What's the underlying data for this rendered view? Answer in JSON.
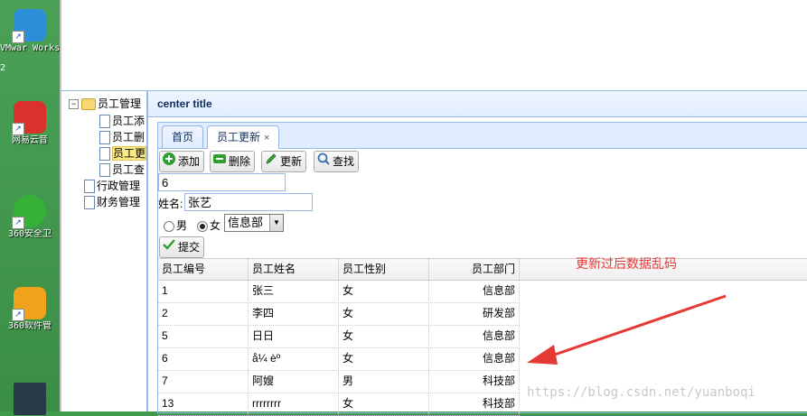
{
  "desktop": {
    "icons": [
      {
        "label": "VMwar Workstat",
        "color": "#2a8fd6"
      },
      {
        "label": "网易云音",
        "color": "#d9312b"
      },
      {
        "label": "360安全卫",
        "color": "#35b236"
      },
      {
        "label": "360软件管",
        "color": "#f0a21c"
      }
    ],
    "edge_label": "2"
  },
  "center": {
    "title": "center title"
  },
  "tree": {
    "root": "员工管理",
    "children": [
      "员工添",
      "员工删",
      "员工更",
      "员工查"
    ],
    "selected_index": 2,
    "siblings": [
      "行政管理",
      "财务管理"
    ]
  },
  "tabs": [
    {
      "label": "首页",
      "active": false
    },
    {
      "label": "员工更新",
      "active": true,
      "close": "×"
    }
  ],
  "toolbar": {
    "add": "添加",
    "delete": "删除",
    "update": "更新",
    "search": "查找"
  },
  "form": {
    "id_value": "6",
    "name_label": "姓名:",
    "name_value": "张艺",
    "male_label": "男",
    "female_label": "女",
    "gender_selected": "女",
    "dept_selected": "信息部",
    "submit": "提交"
  },
  "grid": {
    "columns": [
      "员工编号",
      "员工姓名",
      "员工性别",
      "员工部门"
    ],
    "rows": [
      [
        "1",
        "张三",
        "女",
        "信息部"
      ],
      [
        "2",
        "李四",
        "女",
        "研发部"
      ],
      [
        "5",
        "日日",
        "女",
        "信息部"
      ],
      [
        "6",
        "å¼ èº",
        "女",
        "信息部"
      ],
      [
        "7",
        "阿嫂",
        "男",
        "科技部"
      ],
      [
        "13",
        "rrrrrrrr",
        "女",
        "科技部"
      ]
    ]
  },
  "annotation": {
    "text": "更新过后数据乱码",
    "color": "#e53935"
  },
  "watermark": "https://blog.csdn.net/yuanboqi"
}
